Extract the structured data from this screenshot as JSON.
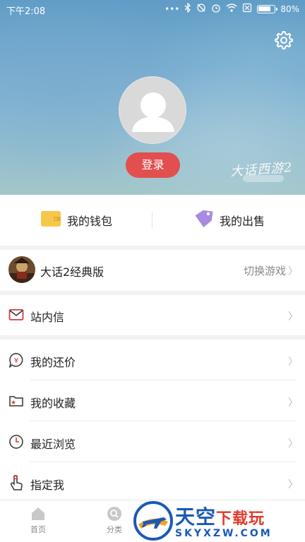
{
  "status_bar": {
    "time": "下午2:08",
    "dots": "•••",
    "battery": "80%",
    "battery_level": 0.8
  },
  "profile": {
    "login_label": "登录",
    "watermark": "大话西游2"
  },
  "wallet": {
    "wallet_label": "我的钱包",
    "sale_label": "我的出售"
  },
  "game": {
    "title": "大话2经典版",
    "switch_label": "切换游戏"
  },
  "messages": {
    "label": "站内信"
  },
  "list": [
    {
      "label": "我的还价",
      "icon": "yuan-bubble-icon"
    },
    {
      "label": "我的收藏",
      "icon": "folder-star-icon"
    },
    {
      "label": "最近浏览",
      "icon": "clock-icon"
    },
    {
      "label": "指定我",
      "icon": "hand-pointer-icon"
    }
  ],
  "chevron": "〉",
  "nav": {
    "home": "首页",
    "category": "分类"
  },
  "promo": {
    "title_main": "天空",
    "title_accent": "下载玩",
    "url": "SKYXZW.COM"
  },
  "colors": {
    "accent": "#e14f4f",
    "brand_blue": "#1a59b7"
  }
}
